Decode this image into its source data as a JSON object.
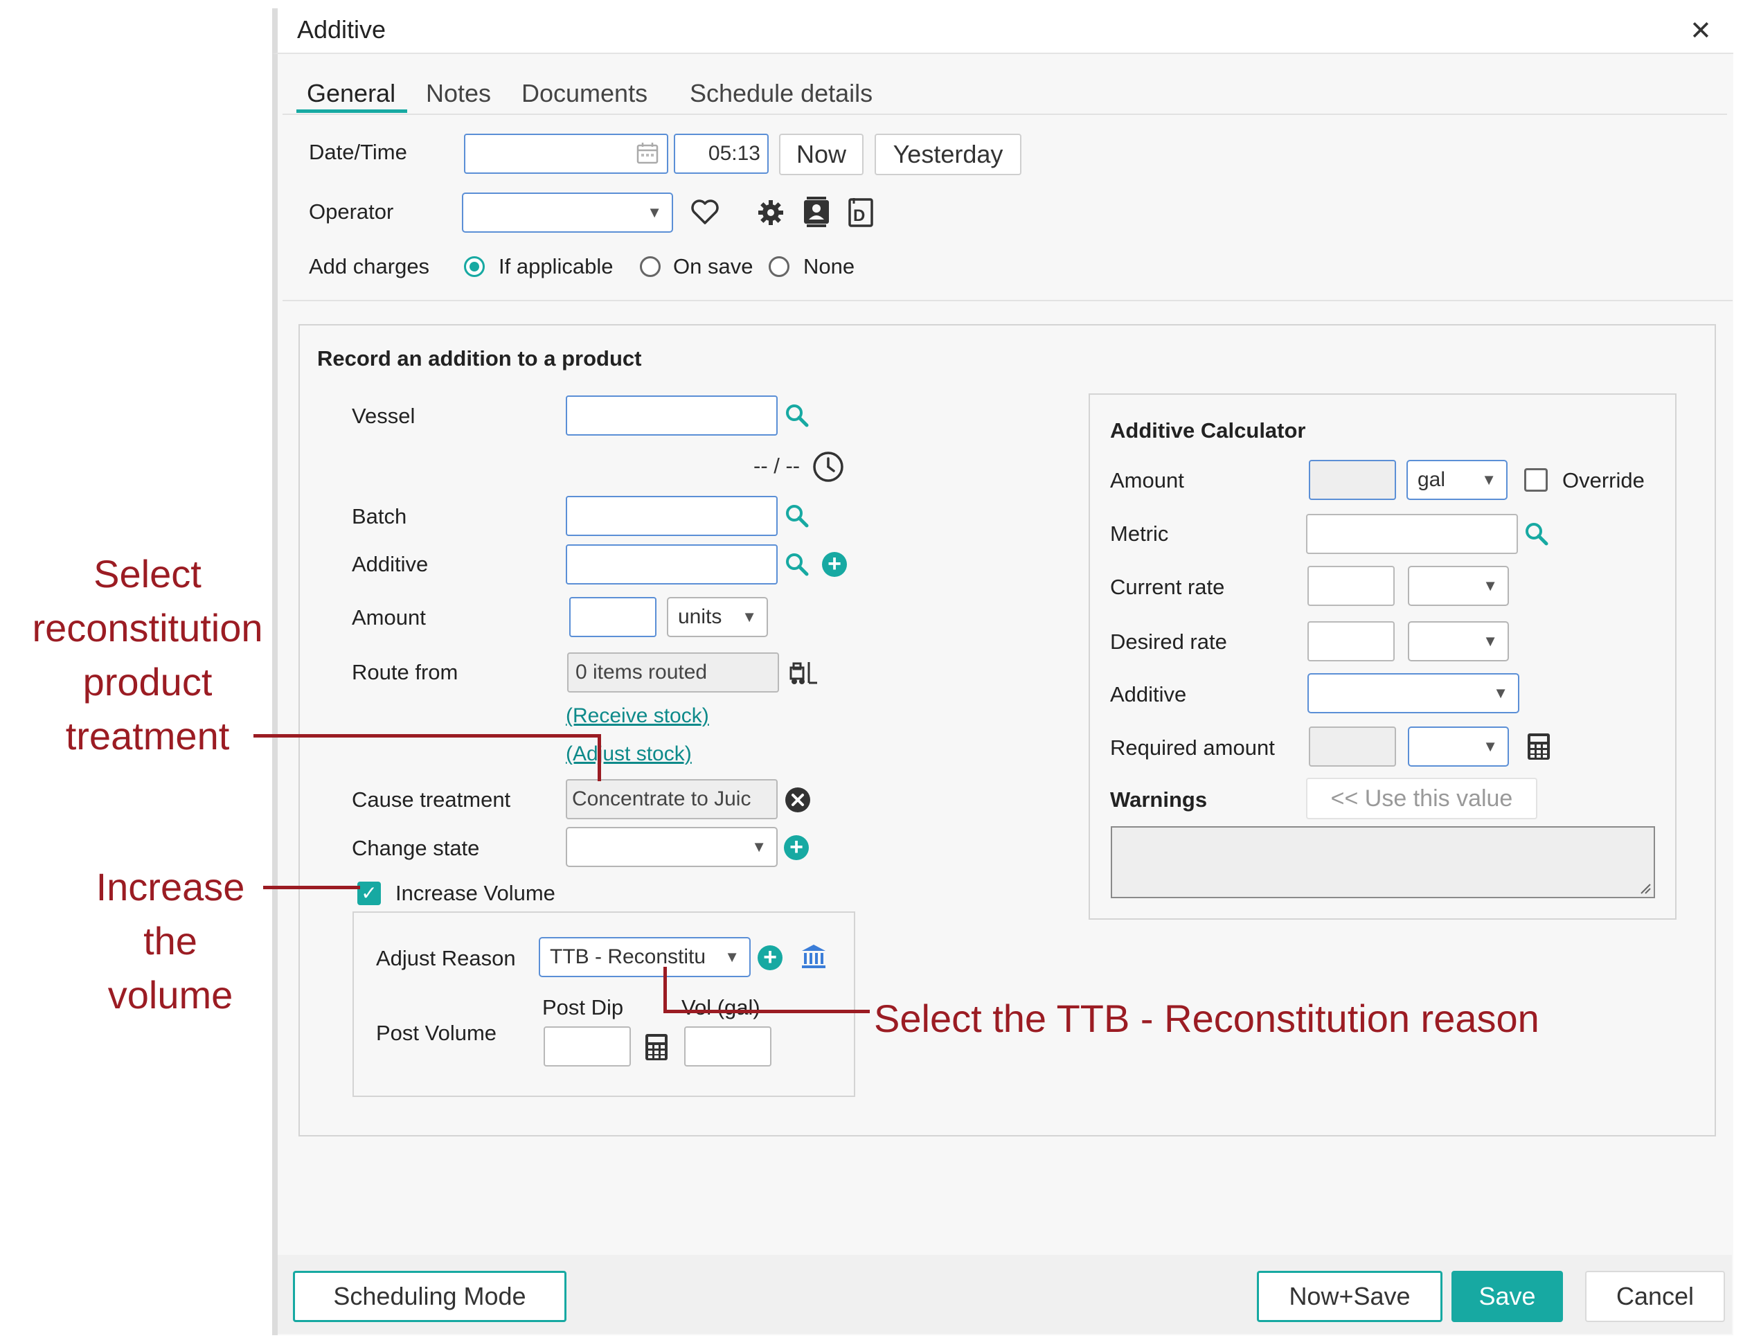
{
  "dialog": {
    "title": "Additive",
    "close_glyph": "✕",
    "tabs": [
      {
        "label": "General",
        "active": true
      },
      {
        "label": "Notes",
        "active": false
      },
      {
        "label": "Documents",
        "active": false
      },
      {
        "label": "Schedule details",
        "active": false
      }
    ]
  },
  "general": {
    "datetime_label": "Date/Time",
    "date_value": "",
    "time_value": "05:13",
    "now_button": "Now",
    "yesterday_button": "Yesterday",
    "operator_label": "Operator",
    "operator_value": "",
    "add_charges_label": "Add charges",
    "charge_options": [
      "If applicable",
      "On save",
      "None"
    ],
    "charge_selected": "If applicable"
  },
  "record": {
    "heading": "Record an addition to a product",
    "vessel_label": "Vessel",
    "vessel_value": "",
    "date_placeholder": "-- / --",
    "batch_label": "Batch",
    "batch_value": "",
    "additive_label": "Additive",
    "additive_value": "",
    "amount_label": "Amount",
    "amount_value": "",
    "amount_unit": "units",
    "route_label": "Route from",
    "route_value": "0 items routed",
    "receive_stock_link": "(Receive stock)",
    "adjust_stock_link": "(Adjust stock)",
    "cause_label": "Cause treatment",
    "cause_value": "Concentrate to Juic",
    "change_state_label": "Change state",
    "change_state_value": "",
    "increase_volume_label": "Increase Volume",
    "increase_volume_checked": true,
    "adjust_reason_label": "Adjust Reason",
    "adjust_reason_value": "TTB - Reconstitu",
    "post_volume_label": "Post Volume",
    "post_dip_label": "Post Dip",
    "vol_label": "Vol (gal)"
  },
  "calculator": {
    "heading": "Additive Calculator",
    "amount_label": "Amount",
    "amount_unit": "gal",
    "override_label": "Override",
    "metric_label": "Metric",
    "current_rate_label": "Current rate",
    "desired_rate_label": "Desired rate",
    "additive_label": "Additive",
    "required_amount_label": "Required amount",
    "warnings_label": "Warnings",
    "use_value_button": "<< Use this value"
  },
  "footer": {
    "scheduling_mode": "Scheduling Mode",
    "now_save": "Now+Save",
    "save": "Save",
    "cancel": "Cancel"
  },
  "annotations": {
    "select_treatment": [
      "Select",
      "reconstitution",
      "product",
      "treatment"
    ],
    "increase_volume": [
      "Increase",
      "the",
      "volume"
    ],
    "select_reason": "Select the TTB - Reconstitution reason"
  },
  "colors": {
    "accent": "#17a9a2",
    "annotation": "#9b1c23",
    "input_border": "#5b8fd6"
  }
}
